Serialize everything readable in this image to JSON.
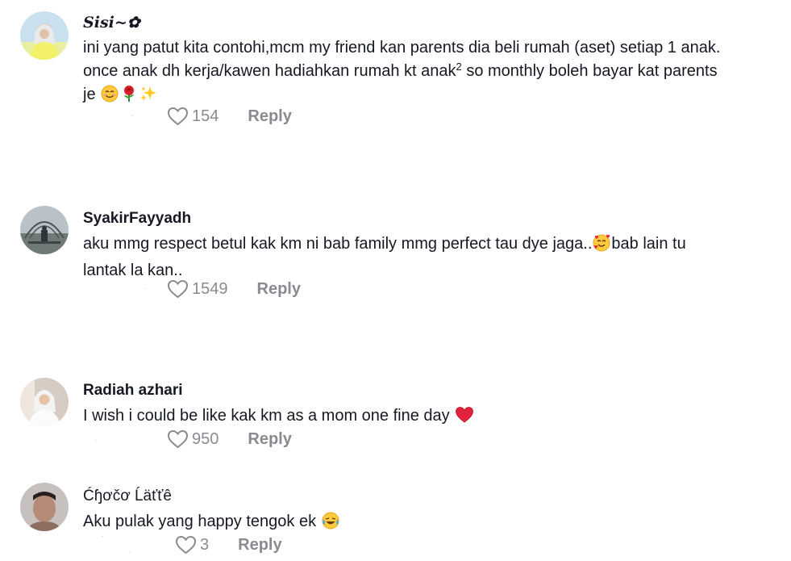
{
  "comments": [
    {
      "username": "Sisi~✿",
      "text_lines": [
        "ini yang patut kita contohi,mcm my friend kan parents dia beli rumah (aset) setiap 1 anak.",
        "once anak dh kerja/kawen hadiahkan rumah kt anak",
        "² so monthly boleh bayar kat parents",
        "je "
      ],
      "emojis": [
        "smiling-face-emoji",
        "rose-emoji",
        "sparkles-emoji"
      ],
      "likes": "154",
      "reply_label": "Reply"
    },
    {
      "username": "SyakirFayyadh",
      "text_lines": [
        "aku mmg respect betul kak km ni bab family mmg perfect tau dye jaga..",
        "bab lain tu",
        "lantak la kan.."
      ],
      "emojis": [
        "smiling-face-with-hearts-emoji"
      ],
      "likes": "1549",
      "reply_label": "Reply"
    },
    {
      "username": "Radiah azhari",
      "text_lines": [
        "I wish i could be like kak km as a mom one fine day "
      ],
      "emojis": [
        "red-heart-emoji"
      ],
      "likes": "950",
      "reply_label": "Reply"
    },
    {
      "username": "Ćɧơčơ Ĺäťťê",
      "text_lines": [
        "Aku pulak yang happy tengok ek "
      ],
      "emojis": [
        "face-with-tears-of-joy-emoji"
      ],
      "likes": "3",
      "reply_label": "Reply"
    }
  ],
  "colors": {
    "text": "#161823",
    "muted": "#8a8b91",
    "heart_red": "#e1223a"
  }
}
